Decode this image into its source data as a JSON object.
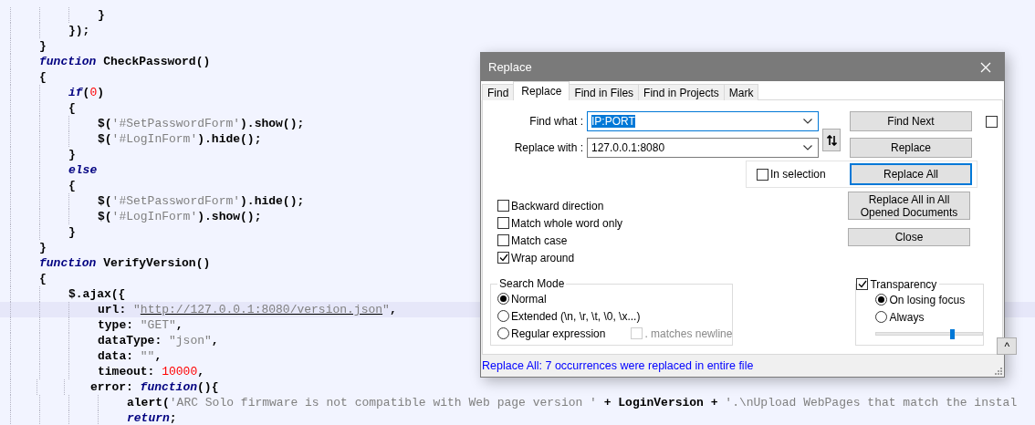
{
  "editor": {
    "lines": [
      {
        "current": false,
        "tokens": [
          {
            "kind": "plain",
            "text": "            }"
          }
        ]
      },
      {
        "current": false,
        "tokens": [
          {
            "kind": "plain",
            "text": "        });"
          }
        ]
      },
      {
        "current": false,
        "tokens": [
          {
            "kind": "plain",
            "text": "    }"
          }
        ]
      },
      {
        "current": false,
        "tokens": [
          {
            "kind": "keyword",
            "text": "    function"
          },
          {
            "kind": "plain",
            "text": " CheckPassword()"
          }
        ]
      },
      {
        "current": false,
        "tokens": [
          {
            "kind": "plain",
            "text": "    {"
          }
        ]
      },
      {
        "current": false,
        "tokens": [
          {
            "kind": "keyword",
            "text": "        if"
          },
          {
            "kind": "plain",
            "text": "("
          },
          {
            "kind": "number",
            "text": "0"
          },
          {
            "kind": "plain",
            "text": ")"
          }
        ]
      },
      {
        "current": false,
        "tokens": [
          {
            "kind": "plain",
            "text": "        {"
          }
        ]
      },
      {
        "current": false,
        "tokens": [
          {
            "kind": "plain",
            "text": "            $("
          },
          {
            "kind": "string",
            "text": "'#SetPasswordForm'"
          },
          {
            "kind": "plain",
            "text": ").show();"
          }
        ]
      },
      {
        "current": false,
        "tokens": [
          {
            "kind": "plain",
            "text": "            $("
          },
          {
            "kind": "string",
            "text": "'#LogInForm'"
          },
          {
            "kind": "plain",
            "text": ").hide();"
          }
        ]
      },
      {
        "current": false,
        "tokens": [
          {
            "kind": "plain",
            "text": "        }"
          }
        ]
      },
      {
        "current": false,
        "tokens": [
          {
            "kind": "keyword",
            "text": "        else"
          }
        ]
      },
      {
        "current": false,
        "tokens": [
          {
            "kind": "plain",
            "text": "        {"
          }
        ]
      },
      {
        "current": false,
        "tokens": [
          {
            "kind": "plain",
            "text": "            $("
          },
          {
            "kind": "string",
            "text": "'#SetPasswordForm'"
          },
          {
            "kind": "plain",
            "text": ").hide();"
          }
        ]
      },
      {
        "current": false,
        "tokens": [
          {
            "kind": "plain",
            "text": "            $("
          },
          {
            "kind": "string",
            "text": "'#LogInForm'"
          },
          {
            "kind": "plain",
            "text": ").show();"
          }
        ]
      },
      {
        "current": false,
        "tokens": [
          {
            "kind": "plain",
            "text": "        }"
          }
        ]
      },
      {
        "current": false,
        "tokens": [
          {
            "kind": "plain",
            "text": "    }"
          }
        ]
      },
      {
        "current": false,
        "tokens": [
          {
            "kind": "keyword",
            "text": "    function"
          },
          {
            "kind": "plain",
            "text": " VerifyVersion()"
          }
        ]
      },
      {
        "current": false,
        "tokens": [
          {
            "kind": "plain",
            "text": "    {"
          }
        ]
      },
      {
        "current": false,
        "tokens": [
          {
            "kind": "plain",
            "text": "        $.ajax({"
          }
        ]
      },
      {
        "current": true,
        "tokens": [
          {
            "kind": "plain",
            "text": "            url: "
          },
          {
            "kind": "string",
            "text": "\""
          },
          {
            "kind": "url",
            "text": "http://127.0.0.1:8080/version.json"
          },
          {
            "kind": "string",
            "text": "\""
          },
          {
            "kind": "plain",
            "text": ","
          }
        ]
      },
      {
        "current": false,
        "tokens": [
          {
            "kind": "plain",
            "text": "            type: "
          },
          {
            "kind": "string",
            "text": "\"GET\""
          },
          {
            "kind": "plain",
            "text": ","
          }
        ]
      },
      {
        "current": false,
        "tokens": [
          {
            "kind": "plain",
            "text": "            dataType: "
          },
          {
            "kind": "string",
            "text": "\"json\""
          },
          {
            "kind": "plain",
            "text": ","
          }
        ]
      },
      {
        "current": false,
        "tokens": [
          {
            "kind": "plain",
            "text": "            data: "
          },
          {
            "kind": "string",
            "text": "\"\""
          },
          {
            "kind": "plain",
            "text": ","
          }
        ]
      },
      {
        "current": false,
        "tokens": [
          {
            "kind": "plain",
            "text": "            timeout: "
          },
          {
            "kind": "number",
            "text": "10000"
          },
          {
            "kind": "plain",
            "text": ","
          }
        ]
      },
      {
        "current": false,
        "tokens": [
          {
            "kind": "plain",
            "text": "           error: "
          },
          {
            "kind": "keyword",
            "text": "function"
          },
          {
            "kind": "plain",
            "text": "(){"
          }
        ]
      },
      {
        "current": false,
        "tokens": [
          {
            "kind": "plain",
            "text": "                alert("
          },
          {
            "kind": "string",
            "text": "'ARC Solo firmware is not compatible with Web page version '"
          },
          {
            "kind": "plain",
            "text": " + LoginVersion + "
          },
          {
            "kind": "string",
            "text": "'.\\nUpload WebPages that match the instal"
          }
        ]
      },
      {
        "current": false,
        "tokens": [
          {
            "kind": "keyword",
            "text": "                return"
          },
          {
            "kind": "plain",
            "text": ";"
          }
        ]
      }
    ]
  },
  "dialog": {
    "title": "Replace",
    "tabs": [
      {
        "label": "Find",
        "selected": false
      },
      {
        "label": "Replace",
        "selected": true
      },
      {
        "label": "Find in Files",
        "selected": false
      },
      {
        "label": "Find in Projects",
        "selected": false
      },
      {
        "label": "Mark",
        "selected": false
      }
    ],
    "find_what": {
      "label": "Find what :",
      "value": "IP:PORT",
      "focused": true,
      "text_selected": true
    },
    "replace_with": {
      "label": "Replace with :",
      "value": "127.0.0.1:8080",
      "focused": false,
      "text_selected": false
    },
    "find_next_button": {
      "label": "Find Next",
      "focused": false
    },
    "side_checkbox": {
      "checked": false
    },
    "replace_button": {
      "label": "Replace",
      "focused": false
    },
    "in_selection": {
      "label": "In selection",
      "checked": false
    },
    "replace_all_button": {
      "label": "Replace All",
      "focused": true
    },
    "replace_all_docs_button": {
      "label": "Replace All in All Opened Documents",
      "focused": false
    },
    "close_button": {
      "label": "Close",
      "focused": false
    },
    "options": [
      {
        "label": "Backward direction",
        "checked": false
      },
      {
        "label": "Match whole word only",
        "checked": false
      },
      {
        "label": "Match case",
        "checked": false
      },
      {
        "label": "Wrap around",
        "checked": true
      }
    ],
    "search_mode": {
      "title": "Search Mode",
      "modes": [
        {
          "label": "Normal",
          "selected": true
        },
        {
          "label": "Extended (\\n, \\r, \\t, \\0, \\x...)",
          "selected": false
        },
        {
          "label": "Regular expression",
          "selected": false
        }
      ],
      "dot_matches_newline": {
        "label": ". matches newline",
        "checked": false,
        "disabled": true
      }
    },
    "transparency": {
      "label": "Transparency",
      "checked": true,
      "modes": [
        {
          "label": "On losing focus",
          "selected": true
        },
        {
          "label": "Always",
          "selected": false
        }
      ],
      "slider": {
        "level": 0.71
      }
    },
    "collapse_button": {
      "label": "^"
    },
    "status": "Replace All: 7 occurrences were replaced in entire file"
  }
}
